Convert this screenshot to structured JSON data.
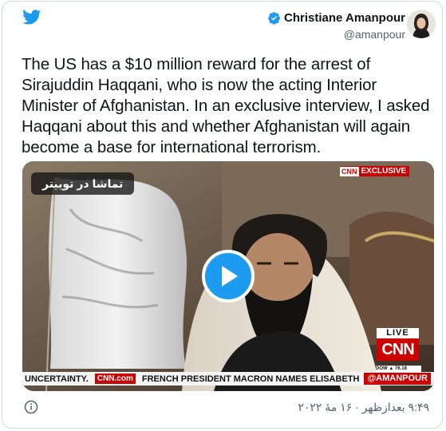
{
  "header": {
    "display_name": "Christiane Amanpour",
    "handle": "@amanpour"
  },
  "tweet": {
    "text": "The US has a $10 million reward for the arrest of Sirajuddin Haqqani, who is now the acting Interior Minister of Afghanistan. In an exclusive interview, I asked Haqqani about this and whether Afghanistan will again become a base for international terrorism."
  },
  "video": {
    "watch_label": "تماشا در توییتر",
    "exclusive_cnn": "CNN",
    "exclusive_label": "EXCLUSIVE",
    "live_label": "LIVE",
    "live_logo": "CNN",
    "ticker_small": "DOW ▲ 76.18",
    "crawl_left": "UNCERTAINTY.",
    "crawl_cnncom": "CNN.com",
    "crawl_main": "FRENCH PRESIDENT MACRON NAMES ELISABETH",
    "crawl_handle": "@AMANPOUR"
  },
  "footer": {
    "timestamp": "۹:۴۹ بعدازظهر · ۱۶ مهٔ ۲۰۲۲"
  },
  "colors": {
    "accent": "#1d9bf0",
    "text": "#0f1419",
    "muted": "#536471",
    "cnn_red": "#cc0000"
  },
  "icons": [
    "twitter-bird-icon",
    "verified-badge-icon",
    "play-icon",
    "info-icon"
  ]
}
